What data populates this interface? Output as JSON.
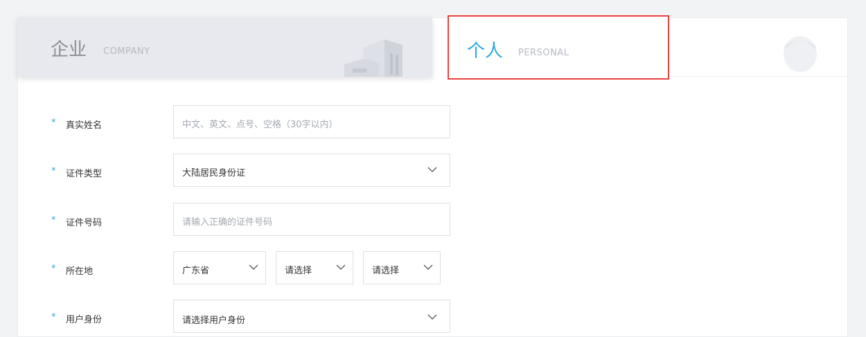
{
  "tabs": {
    "company": {
      "title_cn": "企业",
      "title_en": "COMPANY"
    },
    "personal": {
      "title_cn": "个人",
      "title_en": "PERSONAL"
    }
  },
  "form": {
    "real_name": {
      "required": "*",
      "label": "真实姓名",
      "placeholder": "中文、英文、点号、空格（30字以内）"
    },
    "id_type": {
      "required": "*",
      "label": "证件类型",
      "value": "大陆居民身份证"
    },
    "id_number": {
      "required": "*",
      "label": "证件号码",
      "placeholder": "请输入正确的证件号码"
    },
    "location": {
      "required": "*",
      "label": "所在地",
      "province": "广东省",
      "city": "请选择",
      "district": "请选择"
    },
    "user_identity": {
      "required": "*",
      "label": "用户身份",
      "value": "请选择用户身份"
    }
  },
  "colors": {
    "accent": "#2aa9e0",
    "highlight_border": "#e8413e"
  }
}
